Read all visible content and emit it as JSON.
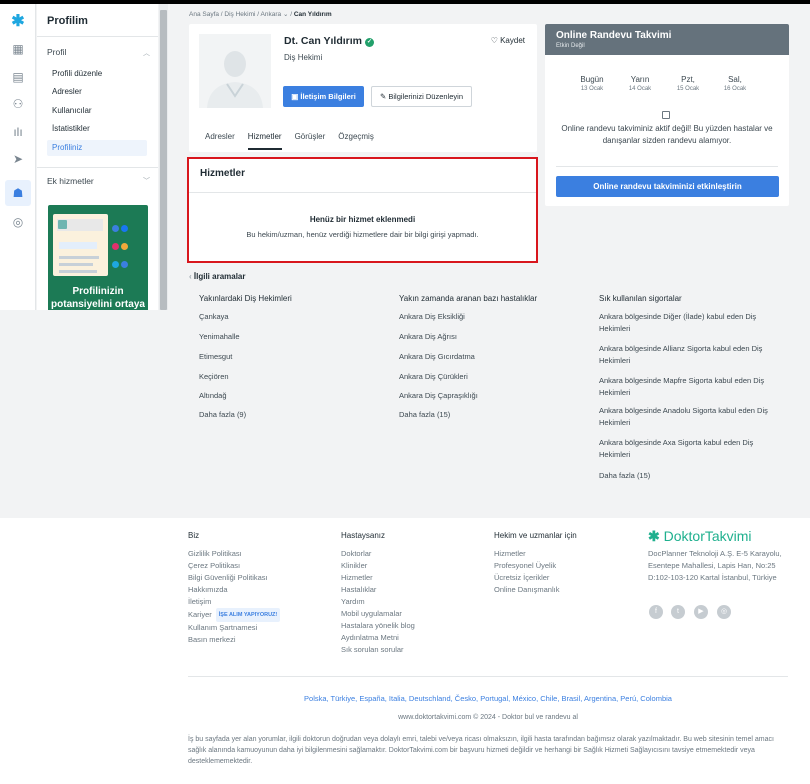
{
  "rail": {
    "icons": [
      "logo-icon",
      "calendar-icon",
      "chat-icon",
      "users-icon",
      "stats-icon",
      "send-icon",
      "doctor-icon",
      "badge-icon"
    ]
  },
  "sidebar": {
    "title": "Profilim",
    "profile_section": "Profil",
    "items": [
      {
        "label": "Profili düzenle"
      },
      {
        "label": "Adresler"
      },
      {
        "label": "Kullanıcılar"
      },
      {
        "label": "İstatistikler"
      },
      {
        "label": "Profiliniz"
      }
    ],
    "extra_section": "Ek hizmetler",
    "promo_text": "Profilinizin potansiyelini ortaya"
  },
  "breadcrumb": {
    "items": [
      "Ana Sayfa",
      "Diş Hekimi",
      "Ankara"
    ],
    "current": "Can Yıldırım"
  },
  "profile": {
    "name": "Dt. Can Yıldırım",
    "specialty": "Diş Hekimi",
    "save_label": "Kaydet",
    "contact_button": "İletişim Bilgileri",
    "edit_button": "Bilgilerinizi Düzenleyin",
    "tabs": [
      "Adresler",
      "Hizmetler",
      "Görüşler",
      "Özgeçmiş"
    ],
    "active_tab": "Hizmetler"
  },
  "services": {
    "title": "Hizmetler",
    "empty_title": "Henüz bir hizmet eklenmedi",
    "empty_text": "Bu hekim/uzman, henüz verdiği hizmetlere dair bir bilgi girişi yapmadı."
  },
  "calendar": {
    "title": "Online Randevu Takvimi",
    "subtitle": "Etkin Değil",
    "days": [
      {
        "name": "Bugün",
        "date": "13 Ocak"
      },
      {
        "name": "Yarın",
        "date": "14 Ocak"
      },
      {
        "name": "Pzt,",
        "date": "15 Ocak"
      },
      {
        "name": "Sal,",
        "date": "16 Ocak"
      }
    ],
    "message": "Online randevu takviminiz aktif değil! Bu yüzden hastalar ve danışanlar sizden randevu alamıyor.",
    "activate_button": "Online randevu takviminizi etkinleştirin"
  },
  "related": {
    "title": "İlgili aramalar",
    "columns": [
      {
        "heading": "Yakınlardaki Diş Hekimleri",
        "links": [
          "Çankaya",
          "Yenimahalle",
          "Etimesgut",
          "Keçiören",
          "Altındağ",
          "Daha fazla (9)"
        ]
      },
      {
        "heading": "Yakın zamanda aranan bazı hastalıklar",
        "links": [
          "Ankara Diş Eksikliği",
          "Ankara Diş Ağrısı",
          "Ankara Diş Gıcırdatma",
          "Ankara Diş Çürükleri",
          "Ankara Diş Çapraşıklığı",
          "Daha fazla (15)"
        ]
      },
      {
        "heading": "Sık kullanılan sigortalar",
        "links": [
          "Ankara bölgesinde Diğer (İlade) kabul eden Diş Hekimleri",
          "Ankara bölgesinde Allianz Sigorta kabul eden Diş Hekimleri",
          "Ankara bölgesinde Mapfre Sigorta kabul eden Diş Hekimleri",
          "Ankara bölgesinde Anadolu Sigorta kabul eden Diş Hekimleri",
          "Ankara bölgesinde Axa Sigorta kabul eden Diş Hekimleri",
          "Daha fazla (15)"
        ]
      }
    ]
  },
  "footer": {
    "columns": [
      {
        "heading": "Biz",
        "links": [
          "Gizlilik Politikası",
          "Çerez Politikası",
          "Bilgi Güvenliği Politikası",
          "Hakkımızda",
          "İletişim",
          "Kariyer",
          "Kullanım Şartnamesi",
          "Basın merkezi"
        ]
      },
      {
        "heading": "Hastaysanız",
        "links": [
          "Doktorlar",
          "Klinikler",
          "Hizmetler",
          "Hastalıklar",
          "Yardım",
          "Mobil uygulamalar",
          "Hastalara yönelik blog",
          "Aydınlatma Metni",
          "Sık sorulan sorular"
        ]
      },
      {
        "heading": "Hekim ve uzmanlar için",
        "links": [
          "Hizmetler",
          "Profesyonel Üyelik",
          "Ücretsiz İçerikler",
          "Online Danışmanlık"
        ]
      }
    ],
    "hiring_badge": "İŞE ALIM YAPIYORUZ!",
    "brand": "DoktorTakvimi",
    "address": "DocPlanner Teknoloji A.Ş. E-5 Karayolu, Esentepe Mahallesi, Lapis Han, No:25 D:102-103-120 Kartal İstanbul, Türkiye",
    "countries": "Polska, Türkiye, España, Italia, Deutschland, Česko, Portugal, México, Chile, Brasil, Argentina, Perú, Colombia",
    "copyright": "www.doktortakvimi.com © 2024 - Doktor bul ve randevu al",
    "disclaimer": "İş bu sayfada yer alan yorumlar, ilgili doktorun doğrudan veya dolaylı emri, talebi ve/veya ricası olmaksızın, ilgili hasta tarafından bağımsız olarak yazılmaktadır. Bu web sitesinin temel amacı sağlık alanında kamuoyunun daha iyi bilgilenmesini sağlamaktır. DoktorTakvimi.com bir başvuru hizmeti değildir ve herhangi bir Sağlık Hizmeti Sağlayıcısını tavsiye etmemektedir veya desteklememektedir."
  }
}
